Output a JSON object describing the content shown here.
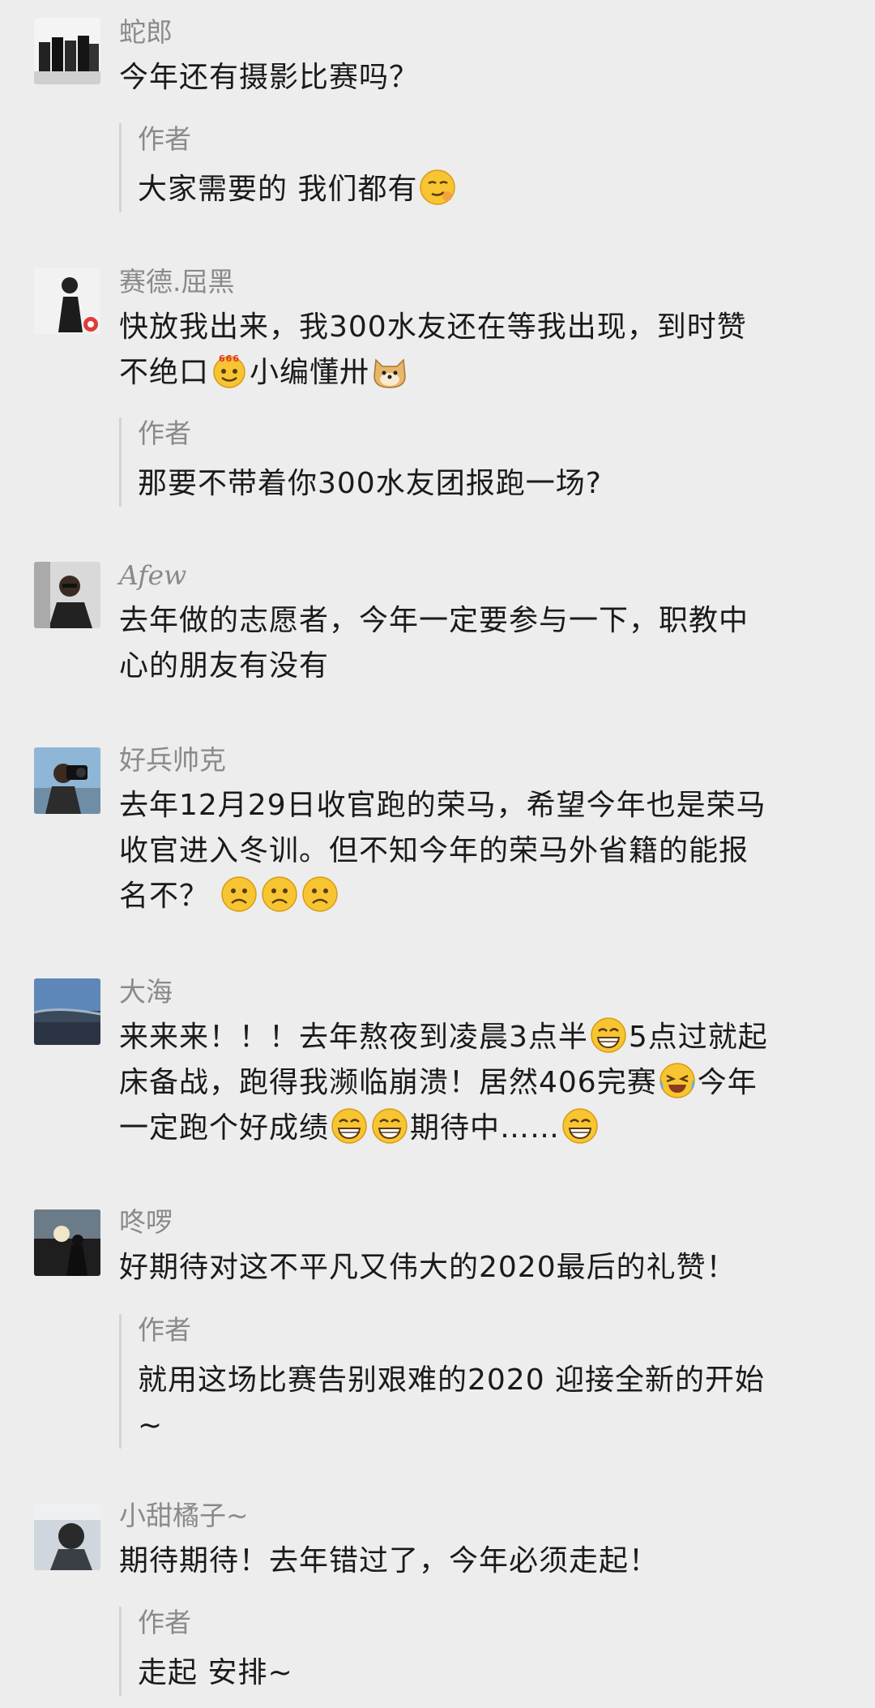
{
  "comments": [
    {
      "name": "蛇郎",
      "text": "今年还有摄影比赛吗？",
      "reply_label": "作者",
      "reply_text": "大家需要的 我们都有",
      "reply_emoji": "smirk-emoji"
    },
    {
      "name": "赛德.屈黑",
      "text_line1": "快放我出来，我300水友还在等我出现，到时赞",
      "text_line2a": "不绝口",
      "emoji_a": "666-emoji",
      "text_line2b": "小编懂卅",
      "emoji_b": "doge-emoji",
      "reply_label": "作者",
      "reply_text": "那要不带着你300水友团报跑一场?"
    },
    {
      "name": "Afew",
      "text_line1": "去年做的志愿者，今年一定要参与一下，职教中",
      "text_line2": "心的朋友有没有"
    },
    {
      "name": "好兵帅克",
      "text_line1": "去年12月29日收官跑的荣马，希望今年也是荣马",
      "text_line2": "收官进入冬训。但不知今年的荣马外省籍的能报",
      "text_line3": "名不？",
      "emoji": "frown-emoji"
    },
    {
      "name": "大海",
      "line1a": "来来来！！！去年熬夜到凌晨3点半",
      "line1b": "5点过就起",
      "line2a": "床备战，跑得我濒临崩溃！居然406完赛",
      "line2b": "今年",
      "line3a": "一定跑个好成绩",
      "line3b": "期待中……",
      "emoji_grin": "grin-emoji",
      "emoji_cry": "cry-laugh-emoji"
    },
    {
      "name": "咚啰",
      "text": "好期待对这不平凡又伟大的2020最后的礼赞！",
      "reply_label": "作者",
      "reply_line1": "就用这场比赛告别艰难的2020 迎接全新的开始",
      "reply_line2": "~"
    },
    {
      "name": "小甜橘子~",
      "text": "期待期待！去年错过了，今年必须走起！",
      "reply_label": "作者",
      "reply_text": "走起 安排~"
    }
  ],
  "colors": {
    "background": "#ededed",
    "name": "#8a8a8a",
    "text": "#1a1a1a",
    "reply_bar": "#d4d4d4",
    "emoji_face": "#f7c531"
  }
}
